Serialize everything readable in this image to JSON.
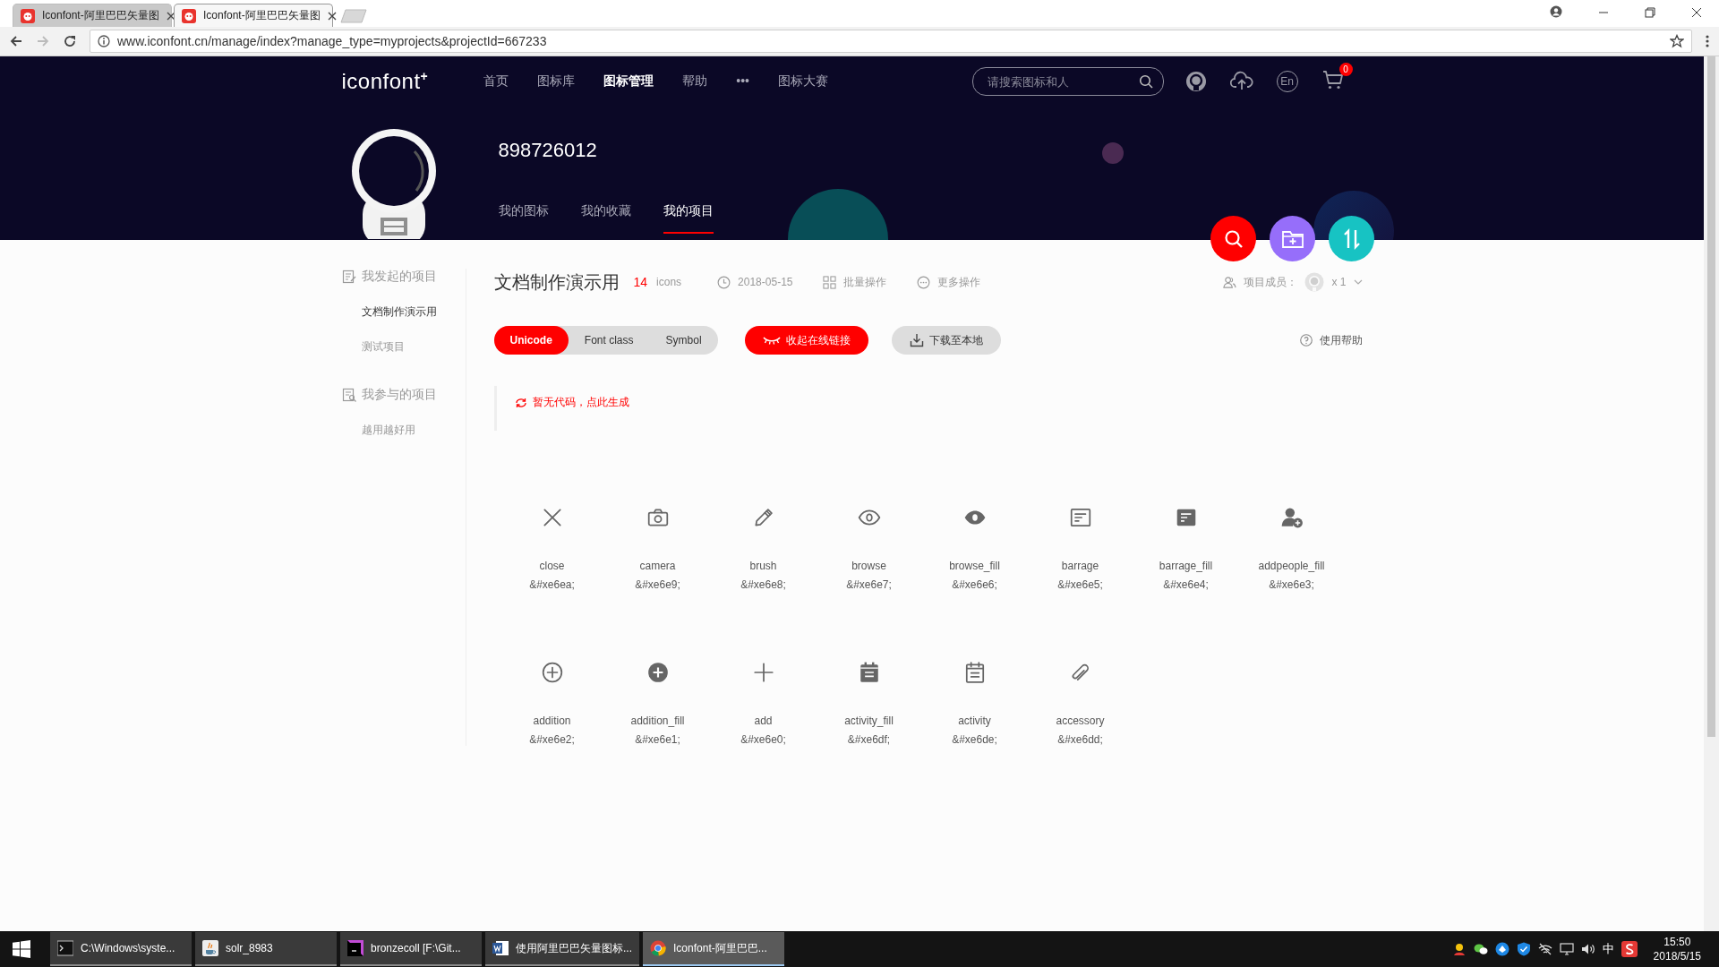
{
  "browser": {
    "tabs": [
      {
        "title": "Iconfont-阿里巴巴矢量图",
        "selected": false
      },
      {
        "title": "Iconfont-阿里巴巴矢量图",
        "selected": true
      }
    ],
    "url": "www.iconfont.cn/manage/index?manage_type=myprojects&projectId=667233"
  },
  "header": {
    "logo": "iconfont$^{+}$",
    "nav": [
      {
        "label": "首页",
        "selected": false
      },
      {
        "label": "图标库",
        "selected": false
      },
      {
        "label": "图标管理",
        "selected": true
      },
      {
        "label": "帮助",
        "selected": false
      },
      {
        "label": "•••",
        "selected": false
      },
      {
        "label": "图标大赛",
        "selected": false
      }
    ],
    "search": {
      "placeholder": "请搜索图标和人"
    },
    "language": "En",
    "cart_count": "0",
    "user_name": "898726012",
    "profile_tabs": [
      {
        "label": "我的图标",
        "selected": false
      },
      {
        "label": "我的收藏",
        "selected": false
      },
      {
        "label": "我的项目",
        "selected": true
      }
    ]
  },
  "sidebar": [
    {
      "title": "我发起的项目",
      "kind": "own",
      "items": [
        {
          "label": "文档制作演示用",
          "selected": true
        },
        {
          "label": "测试项目",
          "selected": false
        }
      ]
    },
    {
      "title": "我参与的项目",
      "kind": "joined",
      "items": [
        {
          "label": "越用越好用",
          "selected": false
        }
      ]
    }
  ],
  "project": {
    "title": "文档制作演示用",
    "count": "14",
    "count_unit": "icons",
    "date": "2018-05-15",
    "actions": [
      {
        "label": "批量操作",
        "kind": "batch"
      },
      {
        "label": "更多操作",
        "kind": "more"
      }
    ],
    "members_label": "项目成员：",
    "members_count": "x 1"
  },
  "code_tabs": [
    {
      "label": "Unicode",
      "selected": true
    },
    {
      "label": "Font class",
      "selected": false
    },
    {
      "label": "Symbol",
      "selected": false
    }
  ],
  "link_button": "收起在线链接",
  "download_button": "下载至本地",
  "help": "使用帮助",
  "code_hint": "暂无代码，点此生成",
  "icons": [
    {
      "name": "close",
      "code": "&#xe6ea;",
      "kind": "close"
    },
    {
      "name": "camera",
      "code": "&#xe6e9;",
      "kind": "camera"
    },
    {
      "name": "brush",
      "code": "&#xe6e8;",
      "kind": "brush"
    },
    {
      "name": "browse",
      "code": "&#xe6e7;",
      "kind": "browse"
    },
    {
      "name": "browse_fill",
      "code": "&#xe6e6;",
      "kind": "browse_fill"
    },
    {
      "name": "barrage",
      "code": "&#xe6e5;",
      "kind": "barrage"
    },
    {
      "name": "barrage_fill",
      "code": "&#xe6e4;",
      "kind": "barrage_fill"
    },
    {
      "name": "addpeople_fill",
      "code": "&#xe6e3;",
      "kind": "addpeople_fill"
    },
    {
      "name": "addition",
      "code": "&#xe6e2;",
      "kind": "addition"
    },
    {
      "name": "addition_fill",
      "code": "&#xe6e1;",
      "kind": "addition_fill"
    },
    {
      "name": "add",
      "code": "&#xe6e0;",
      "kind": "add"
    },
    {
      "name": "activity_fill",
      "code": "&#xe6df;",
      "kind": "activity_fill"
    },
    {
      "name": "activity",
      "code": "&#xe6de;",
      "kind": "activity"
    },
    {
      "name": "accessory",
      "code": "&#xe6dd;",
      "kind": "accessory"
    }
  ],
  "taskbar": {
    "items": [
      {
        "label": "C:\\Windows\\syste...",
        "kind": "terminal",
        "selected": false
      },
      {
        "label": "solr_8983",
        "kind": "java",
        "selected": false
      },
      {
        "label": "bronzecoll [F:\\Git...",
        "kind": "ide",
        "selected": false
      },
      {
        "label": "使用阿里巴巴矢量图标...",
        "kind": "word",
        "selected": false
      },
      {
        "label": "Iconfont-阿里巴巴...",
        "kind": "chrome",
        "selected": true
      }
    ],
    "ime": "中",
    "time": "15:50",
    "date": "2018/5/15"
  }
}
